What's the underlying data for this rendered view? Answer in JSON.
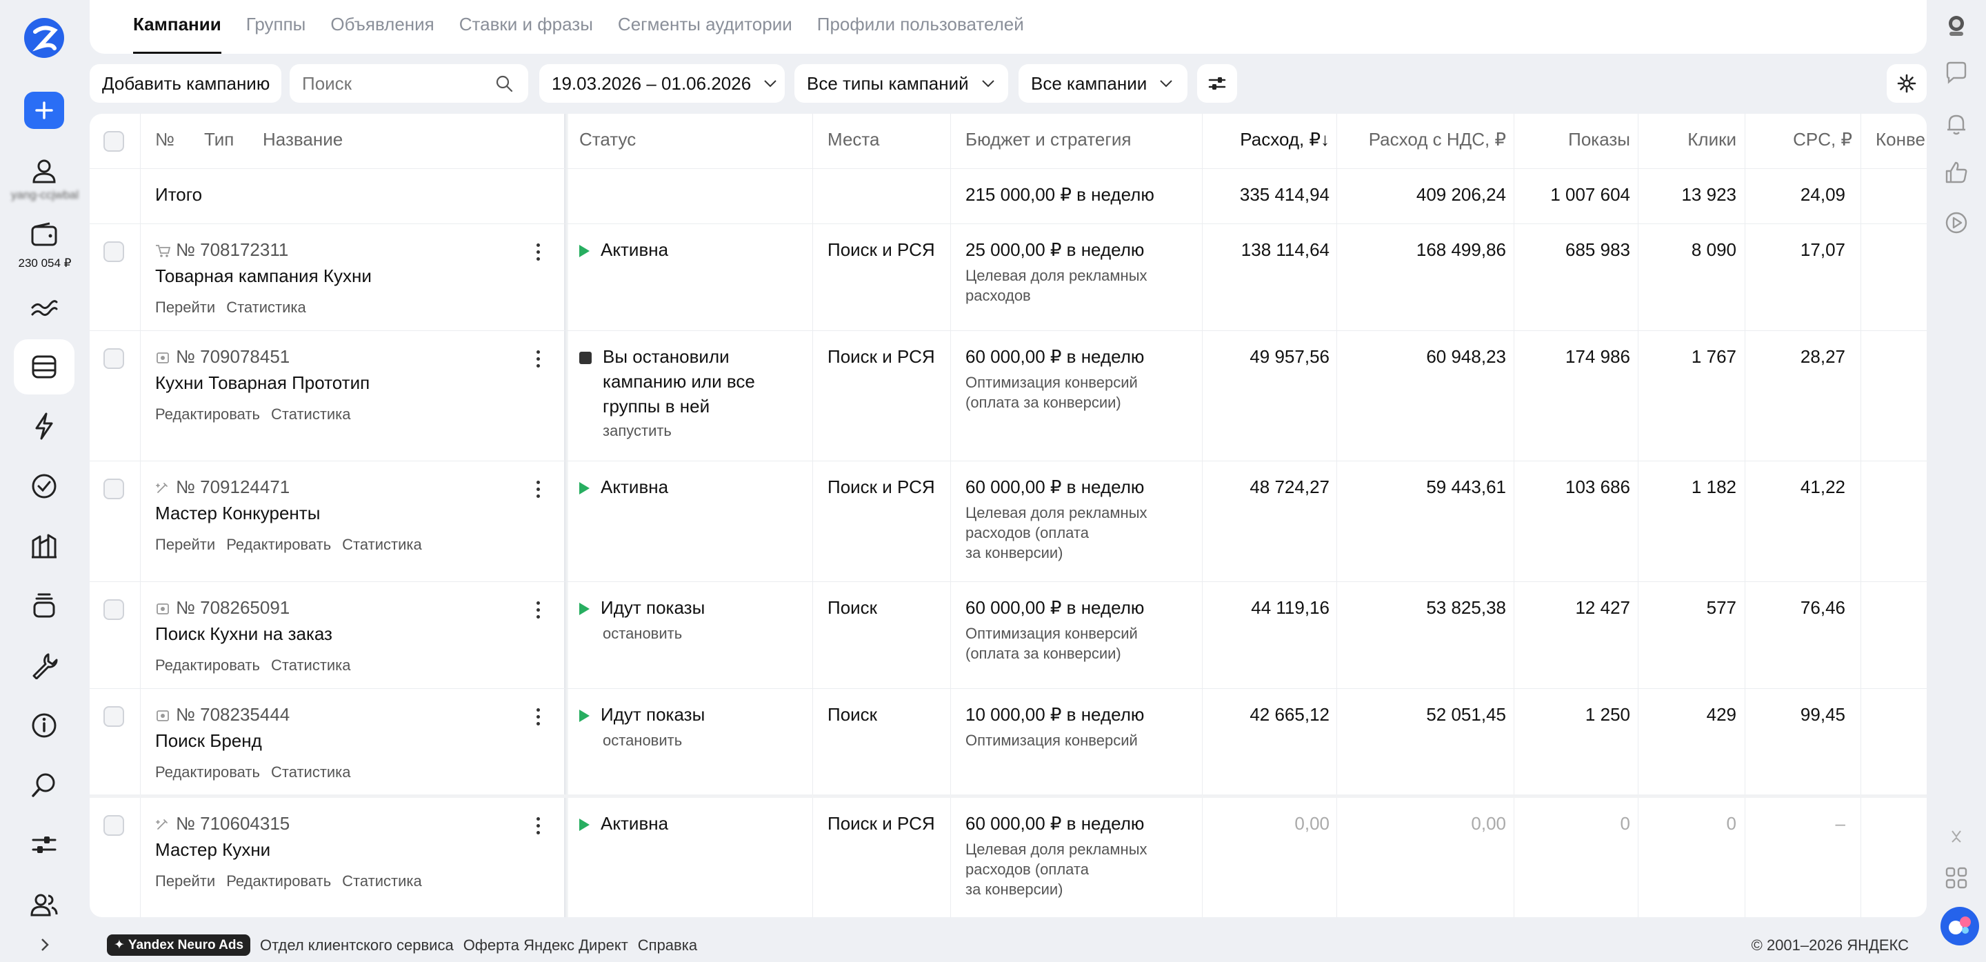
{
  "tabs": [
    "Кампании",
    "Группы",
    "Объявления",
    "Ставки и фразы",
    "Сегменты аудитории",
    "Профили пользователей"
  ],
  "sidebar": {
    "user_name": "yang-ccjwbal",
    "balance": "230 054 ₽"
  },
  "toolbar": {
    "add_campaign": "Добавить кампанию",
    "search_placeholder": "Поиск",
    "date_range": "19.03.2026 – 01.06.2026",
    "campaign_types": "Все типы кампаний",
    "campaigns_filter": "Все кампании"
  },
  "table": {
    "headers": {
      "num": "№",
      "type": "Тип",
      "name": "Название",
      "status": "Статус",
      "places": "Места",
      "budget": "Бюджет и стратегия",
      "spend": "Расход, ₽↓",
      "spend_vat": "Расход с НДС, ₽",
      "impressions": "Показы",
      "clicks": "Клики",
      "cpc": "CPC, ₽",
      "conv": "Конве"
    },
    "total": {
      "label": "Итого",
      "budget": "215 000,00 ₽ в неделю",
      "spend": "335 414,94",
      "spend_vat": "409 206,24",
      "impressions": "1 007 604",
      "clicks": "13 923",
      "cpc": "24,09"
    },
    "rows": [
      {
        "type_icon": "cart-icon",
        "number": "№ 708172311",
        "name": "Товарная кампания Кухни",
        "links": [
          "Перейти",
          "Статистика"
        ],
        "status_icon": "play-icon",
        "status": "Активна",
        "status_action": "",
        "places": "Поиск и РСЯ",
        "budget": "25 000,00 ₽ в неделю",
        "strategy": [
          "Целевая доля рекламных",
          "расходов"
        ],
        "spend": "138 114,64",
        "spend_vat": "168 499,86",
        "impressions": "685 983",
        "clicks": "8 090",
        "cpc": "17,07"
      },
      {
        "type_icon": "text-ad-icon",
        "number": "№ 709078451",
        "name": "Кухни Товарная Прототип",
        "links": [
          "Редактировать",
          "Статистика"
        ],
        "status_icon": "stop-icon",
        "status_lines": [
          "Вы остановили",
          "кампанию или все",
          "группы в ней"
        ],
        "status_action": "запустить",
        "places": "Поиск и РСЯ",
        "budget": "60 000,00 ₽ в неделю",
        "strategy": [
          "Оптимизация конверсий",
          "(оплата за конверсии)"
        ],
        "spend": "49 957,56",
        "spend_vat": "60 948,23",
        "impressions": "174 986",
        "clicks": "1 767",
        "cpc": "28,27"
      },
      {
        "type_icon": "master-icon",
        "number": "№ 709124471",
        "name": "Мастер Конкуренты",
        "links": [
          "Перейти",
          "Редактировать",
          "Статистика"
        ],
        "status_icon": "play-icon",
        "status": "Активна",
        "status_action": "",
        "places": "Поиск и РСЯ",
        "budget": "60 000,00 ₽ в неделю",
        "strategy": [
          "Целевая доля рекламных",
          "расходов (оплата",
          "за конверсии)"
        ],
        "spend": "48 724,27",
        "spend_vat": "59 443,61",
        "impressions": "103 686",
        "clicks": "1 182",
        "cpc": "41,22"
      },
      {
        "type_icon": "text-ad-icon",
        "number": "№ 708265091",
        "name": "Поиск Кухни на заказ",
        "links": [
          "Редактировать",
          "Статистика"
        ],
        "status_icon": "play-icon",
        "status": "Идут показы",
        "status_action": "остановить",
        "places": "Поиск",
        "budget": "60 000,00 ₽ в неделю",
        "strategy": [
          "Оптимизация конверсий",
          "(оплата за конверсии)"
        ],
        "spend": "44 119,16",
        "spend_vat": "53 825,38",
        "impressions": "12 427",
        "clicks": "577",
        "cpc": "76,46"
      },
      {
        "type_icon": "text-ad-icon",
        "number": "№ 708235444",
        "name": "Поиск Бренд",
        "links": [
          "Редактировать",
          "Статистика"
        ],
        "status_icon": "play-icon",
        "status": "Идут показы",
        "status_action": "остановить",
        "places": "Поиск",
        "budget": "10 000,00 ₽ в неделю",
        "strategy": [
          "Оптимизация конверсий"
        ],
        "spend": "42 665,12",
        "spend_vat": "52 051,45",
        "impressions": "1 250",
        "clicks": "429",
        "cpc": "99,45"
      },
      {
        "type_icon": "master-icon",
        "number": "№ 710604315",
        "name": "Мастер Кухни",
        "links": [
          "Перейти",
          "Редактировать",
          "Статистика"
        ],
        "status_icon": "play-icon",
        "status": "Активна",
        "status_action": "",
        "places": "Поиск и РСЯ",
        "budget": "60 000,00 ₽ в неделю",
        "strategy": [
          "Целевая доля рекламных",
          "расходов (оплата",
          "за конверсии)"
        ],
        "spend": "0,00",
        "spend_vat": "0,00",
        "impressions": "0",
        "clicks": "0",
        "cpc": "–"
      }
    ]
  },
  "footer": {
    "badge": "Yandex Neuro Ads",
    "links": [
      "Отдел клиентского сервиса",
      "Оферта Яндекс Директ",
      "Справка"
    ],
    "copyright": "© 2001–2026 ЯНДЕКС"
  },
  "colors": {
    "accent": "#2a6ef5",
    "active_status": "#27ae60",
    "background": "#eef0f4"
  }
}
